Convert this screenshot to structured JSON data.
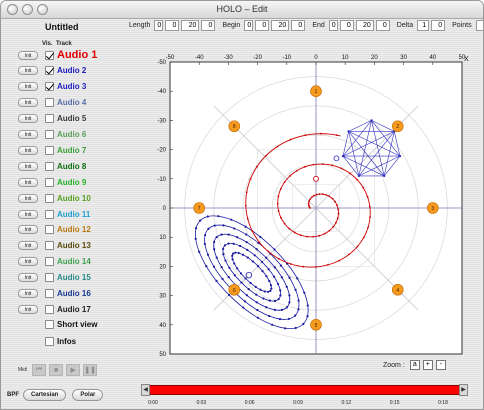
{
  "window": {
    "title": "HOLO – Edit"
  },
  "doc_name": "Untitled",
  "fields": {
    "length": {
      "label": "Length",
      "values": [
        "0",
        "0",
        "20",
        "0"
      ]
    },
    "begin": {
      "label": "Begin",
      "values": [
        "0",
        "0",
        "20",
        "0"
      ]
    },
    "end": {
      "label": "End",
      "values": [
        "0",
        "0",
        "20",
        "0"
      ]
    },
    "delta": {
      "label": "Delta",
      "values": [
        "1",
        "0"
      ]
    },
    "points": {
      "label": "Points",
      "value": "4"
    }
  },
  "columns": {
    "vis": "Vis.",
    "track": "Track"
  },
  "init_label": "Init",
  "tracks": [
    {
      "label": "Audio 1",
      "color": "#e00000",
      "checked": true
    },
    {
      "label": "Audio 2",
      "color": "#1a1ab8",
      "checked": true
    },
    {
      "label": "Audio 3",
      "color": "#2020c0",
      "checked": true
    },
    {
      "label": "Audio 4",
      "color": "#5a6fa8",
      "checked": false
    },
    {
      "label": "Audio 5",
      "color": "#3a3a3a",
      "checked": false
    },
    {
      "label": "Audio 6",
      "color": "#5aa05a",
      "checked": false
    },
    {
      "label": "Audio 7",
      "color": "#3aa03a",
      "checked": false
    },
    {
      "label": "Audio 8",
      "color": "#107010",
      "checked": false
    },
    {
      "label": "Audio 9",
      "color": "#28b028",
      "checked": false
    },
    {
      "label": "Audio 10",
      "color": "#58a020",
      "checked": false
    },
    {
      "label": "Audio 11",
      "color": "#20a0d0",
      "checked": false
    },
    {
      "label": "Audio 12",
      "color": "#b87a10",
      "checked": false
    },
    {
      "label": "Audio 13",
      "color": "#5a4a10",
      "checked": false
    },
    {
      "label": "Audio 14",
      "color": "#40a050",
      "checked": false
    },
    {
      "label": "Audio 15",
      "color": "#2a8a8a",
      "checked": false
    },
    {
      "label": "Audio 16",
      "color": "#1a3a90",
      "checked": false
    },
    {
      "label": "Audio 17",
      "color": "#222222",
      "checked": false
    }
  ],
  "options": {
    "short_view": "Short view",
    "infos": "Infos"
  },
  "midi_label": "Midi",
  "bpf": {
    "label": "BPF",
    "cartesian": "Cartesian",
    "polar": "Polar"
  },
  "zoom": {
    "label": "Zoom :",
    "buttons": [
      "a",
      "+",
      "-"
    ]
  },
  "plot": {
    "x_axis_letter": "X",
    "y_axis_letter": "Y",
    "x_ticks": [
      "-50",
      "-40",
      "-30",
      "-20",
      "-10",
      "0",
      "10",
      "20",
      "30",
      "40",
      "50"
    ],
    "y_ticks": [
      "-50",
      "-40",
      "-30",
      "-20",
      "-10",
      "0",
      "10",
      "20",
      "30",
      "40",
      "50"
    ],
    "speakers": [
      {
        "label": "1"
      },
      {
        "label": "2"
      },
      {
        "label": "3"
      },
      {
        "label": "4"
      },
      {
        "label": "5"
      },
      {
        "label": "6"
      },
      {
        "label": "7"
      },
      {
        "label": "8"
      }
    ]
  },
  "timeline": {
    "left_arrow": "◀",
    "right_arrow": "▶",
    "ticks": [
      "0:00",
      "0:03",
      "0:06",
      "0:09",
      "0:12",
      "0:15",
      "0:18"
    ]
  },
  "colors": {
    "accent_red": "#ff0000",
    "speaker_orange": "#f59a1e",
    "trajectory_red": "#cc0000",
    "trajectory_blue": "#1a1aa0"
  }
}
